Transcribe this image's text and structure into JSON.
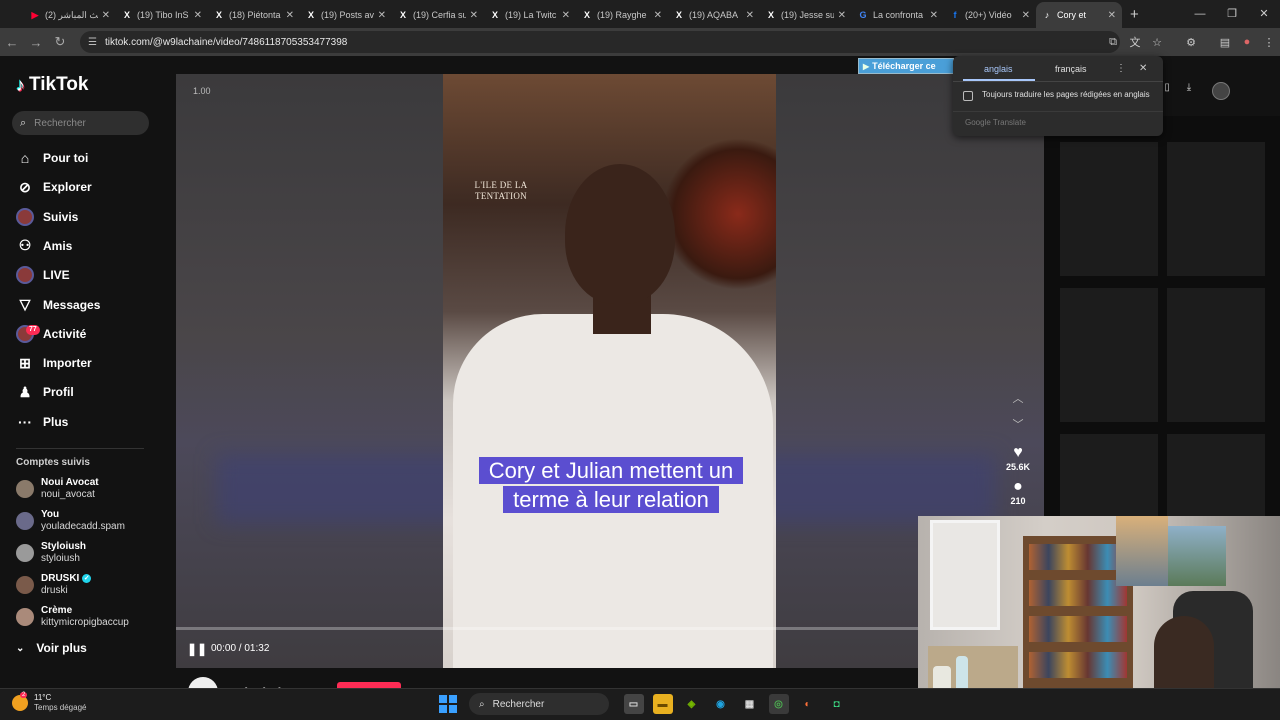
{
  "browser": {
    "tabs": [
      {
        "title": "(2) البث المباشر",
        "favicon": "youtube-icon",
        "color": "#ff0033",
        "glyph": "▶"
      },
      {
        "title": "(19) Tibo InS",
        "favicon": "x-icon",
        "color": "#ffffff",
        "glyph": "X"
      },
      {
        "title": "(18) Piétonta",
        "favicon": "x-icon",
        "color": "#ffffff",
        "glyph": "X"
      },
      {
        "title": "(19) Posts av",
        "favicon": "x-icon",
        "color": "#ffffff",
        "glyph": "X"
      },
      {
        "title": "(19) Cerfia su",
        "favicon": "x-icon",
        "color": "#ffffff",
        "glyph": "X"
      },
      {
        "title": "(19) La Twitc",
        "favicon": "x-icon",
        "color": "#ffffff",
        "glyph": "X"
      },
      {
        "title": "(19) Rayghe",
        "favicon": "x-icon",
        "color": "#ffffff",
        "glyph": "X"
      },
      {
        "title": "(19) AQABA",
        "favicon": "x-icon",
        "color": "#ffffff",
        "glyph": "X"
      },
      {
        "title": "(19) Jesse su",
        "favicon": "x-icon",
        "color": "#ffffff",
        "glyph": "X"
      },
      {
        "title": "La confronta",
        "favicon": "google-icon",
        "color": "#4285f4",
        "glyph": "G"
      },
      {
        "title": "(20+) Vidéo",
        "favicon": "facebook-icon",
        "color": "#1877f2",
        "glyph": "f"
      },
      {
        "title": "Cory et",
        "favicon": "tiktok-icon",
        "color": "#ffffff",
        "glyph": "♪",
        "active": true
      }
    ],
    "url": "tiktok.com/@w9lachaine/video/7486118705353477398"
  },
  "sidebar": {
    "logo": "TikTok",
    "search_placeholder": "Rechercher",
    "nav": [
      {
        "label": "Pour toi",
        "icon": "home-icon"
      },
      {
        "label": "Explorer",
        "icon": "compass-icon"
      },
      {
        "label": "Suivis",
        "icon": "avatar-icon"
      },
      {
        "label": "Amis",
        "icon": "friends-icon"
      },
      {
        "label": "LIVE",
        "icon": "live-avatar-icon"
      },
      {
        "label": "Messages",
        "icon": "messages-icon"
      },
      {
        "label": "Activité",
        "icon": "activity-icon",
        "badge": "77"
      },
      {
        "label": "Importer",
        "icon": "upload-icon"
      },
      {
        "label": "Profil",
        "icon": "profile-icon"
      },
      {
        "label": "Plus",
        "icon": "more-icon"
      }
    ],
    "followed_title": "Comptes suivis",
    "followed": [
      {
        "name": "Noui Avocat",
        "handle": "noui_avocat",
        "verified": false
      },
      {
        "name": "You",
        "handle": "youladecadd.spam",
        "verified": false
      },
      {
        "name": "Styloiush",
        "handle": "styloiush",
        "verified": false
      },
      {
        "name": "DRUSKI",
        "handle": "druski",
        "verified": true
      },
      {
        "name": "Crème",
        "handle": "kittymicropigbaccup",
        "verified": false
      }
    ],
    "see_more": "Voir plus"
  },
  "video": {
    "speed": "1.00",
    "watermark": "L'ILE DE LA TENTATION",
    "caption": "Cory et Julian mettent un terme à leur relation",
    "time": "00:00 / 01:32",
    "progress_fraction": 0.0,
    "likes": "25.6K",
    "comments": "210"
  },
  "author": {
    "name": "w9lachaine"
  },
  "download_button": "Télécharger ce",
  "translate": {
    "lang_from": "anglais",
    "lang_to": "français",
    "always_translate": "Toujours traduire les pages rédigées en anglais",
    "brand": "Google Translate"
  },
  "taskbar": {
    "temperature": "11°C",
    "weather": "Temps dégagé",
    "weather_badge": "2",
    "search": "Rechercher"
  }
}
